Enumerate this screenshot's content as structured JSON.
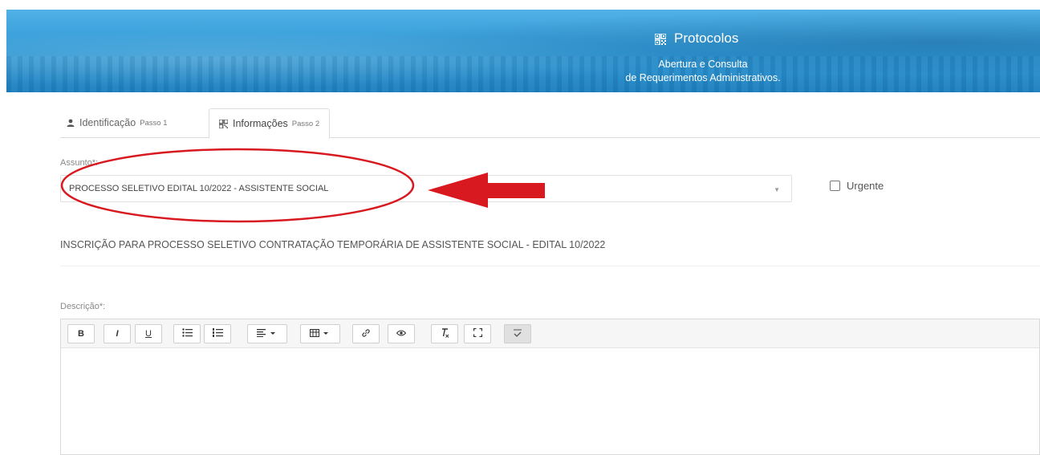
{
  "header": {
    "title": "Protocolos",
    "subtitle_line1": "Abertura e Consulta",
    "subtitle_line2": "de Requerimentos Administrativos.",
    "bg_color": "#2f97d3"
  },
  "tabs": [
    {
      "label": "Identificação",
      "step": "Passo 1",
      "icon": "user-icon",
      "active": false
    },
    {
      "label": "Informações",
      "step": "Passo 2",
      "icon": "qrcode-icon",
      "active": true
    }
  ],
  "form": {
    "assunto_label": "Assunto*:",
    "assunto_value": "PROCESSO SELETIVO EDITAL 10/2022 - ASSISTENTE SOCIAL",
    "urgente_label": "Urgente",
    "assunto_description": "INSCRIÇÃO PARA PROCESSO SELETIVO CONTRATAÇÃO TEMPORÁRIA DE ASSISTENTE SOCIAL - EDITAL 10/2022",
    "descricao_label": "Descrição*:"
  },
  "toolbar": {
    "bold": "B",
    "italic": "I",
    "underline": "U",
    "icons": [
      "bold-icon",
      "italic-icon",
      "underline-icon",
      "bullet-list-icon",
      "numbered-list-icon",
      "align-dropdown-icon",
      "table-dropdown-icon",
      "link-icon",
      "preview-icon",
      "clear-format-icon",
      "fullscreen-icon",
      "spellcheck-icon"
    ]
  },
  "annotation": {
    "color": "#d8191f"
  }
}
